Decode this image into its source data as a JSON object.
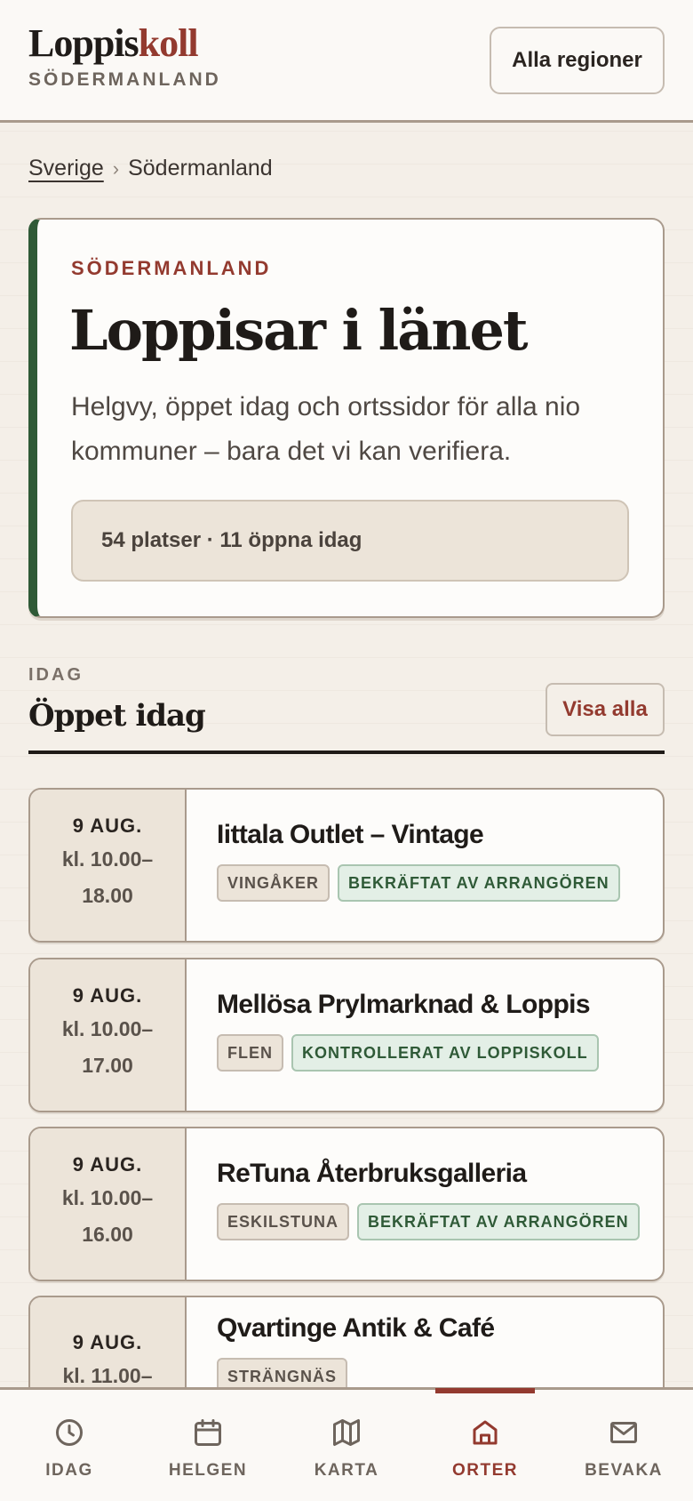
{
  "header": {
    "logo_part1": "Loppis",
    "logo_part2": "koll",
    "logo_sub": "SÖDERMANLAND",
    "region_button": "Alla regioner",
    "brand_color": "#933a2f"
  },
  "breadcrumb": {
    "items": [
      {
        "label": "Sverige",
        "link": true
      },
      {
        "label": "Södermanland",
        "link": false
      }
    ],
    "separator": "›"
  },
  "hero": {
    "kicker": "SÖDERMANLAND",
    "title": "Loppisar i länet",
    "description": "Helgvy, öppet idag och ortssidor för alla nio kommuner – bara det vi kan verifiera.",
    "stats": "54 platser · 11 öppna idag",
    "accent_color": "#2f5a37"
  },
  "section": {
    "kicker": "IDAG",
    "title": "Öppet idag",
    "see_all": "Visa alla"
  },
  "events": [
    {
      "day": "9 AUG.",
      "time1": "kl. 10.00–",
      "time2": "18.00",
      "name": "Iittala Outlet – Vintage",
      "place": "VINGÅKER",
      "verification": "BEKRÄFTAT AV ARRANGÖREN"
    },
    {
      "day": "9 AUG.",
      "time1": "kl. 10.00–",
      "time2": "17.00",
      "name": "Mellösa Prylmarknad & Loppis",
      "place": "FLEN",
      "verification": "KONTROLLERAT AV LOPPISKOLL"
    },
    {
      "day": "9 AUG.",
      "time1": "kl. 10.00–",
      "time2": "16.00",
      "name": "ReTuna Återbruksgalleria",
      "place": "ESKILSTUNA",
      "verification": "BEKRÄFTAT AV ARRANGÖREN"
    },
    {
      "day": "9 AUG.",
      "time1": "kl. 11.00–",
      "time2": "",
      "name": "Qvartinge Antik & Café",
      "place": "STRÄNGNÄS",
      "verification": ""
    }
  ],
  "nav": {
    "items": [
      {
        "label": "IDAG",
        "icon": "clock-icon",
        "active": false
      },
      {
        "label": "HELGEN",
        "icon": "calendar-icon",
        "active": false
      },
      {
        "label": "KARTA",
        "icon": "map-icon",
        "active": false
      },
      {
        "label": "ORTER",
        "icon": "home-icon",
        "active": true
      },
      {
        "label": "BEVAKA",
        "icon": "mail-icon",
        "active": false
      }
    ]
  }
}
